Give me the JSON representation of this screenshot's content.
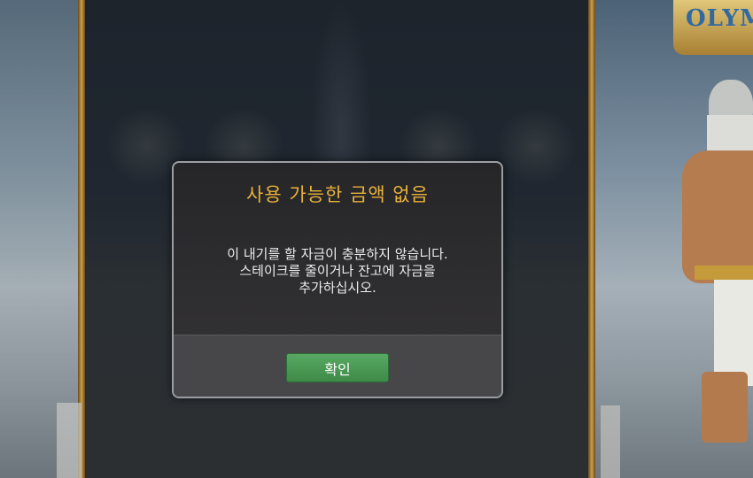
{
  "game": {
    "logo_text": "OLYM"
  },
  "dialog": {
    "title": "사용 가능한 금액 없음",
    "message_lines": [
      "이 내기를 할 자금이 충분하지 않습니다.",
      "스테이크를 줄이거나 잔고에 자금을",
      "추가하십시오."
    ],
    "confirm_label": "확인"
  },
  "colors": {
    "title": "#e8b13a",
    "button": "#4a9a55",
    "panel": "#2f2e30",
    "footer": "#474749"
  }
}
